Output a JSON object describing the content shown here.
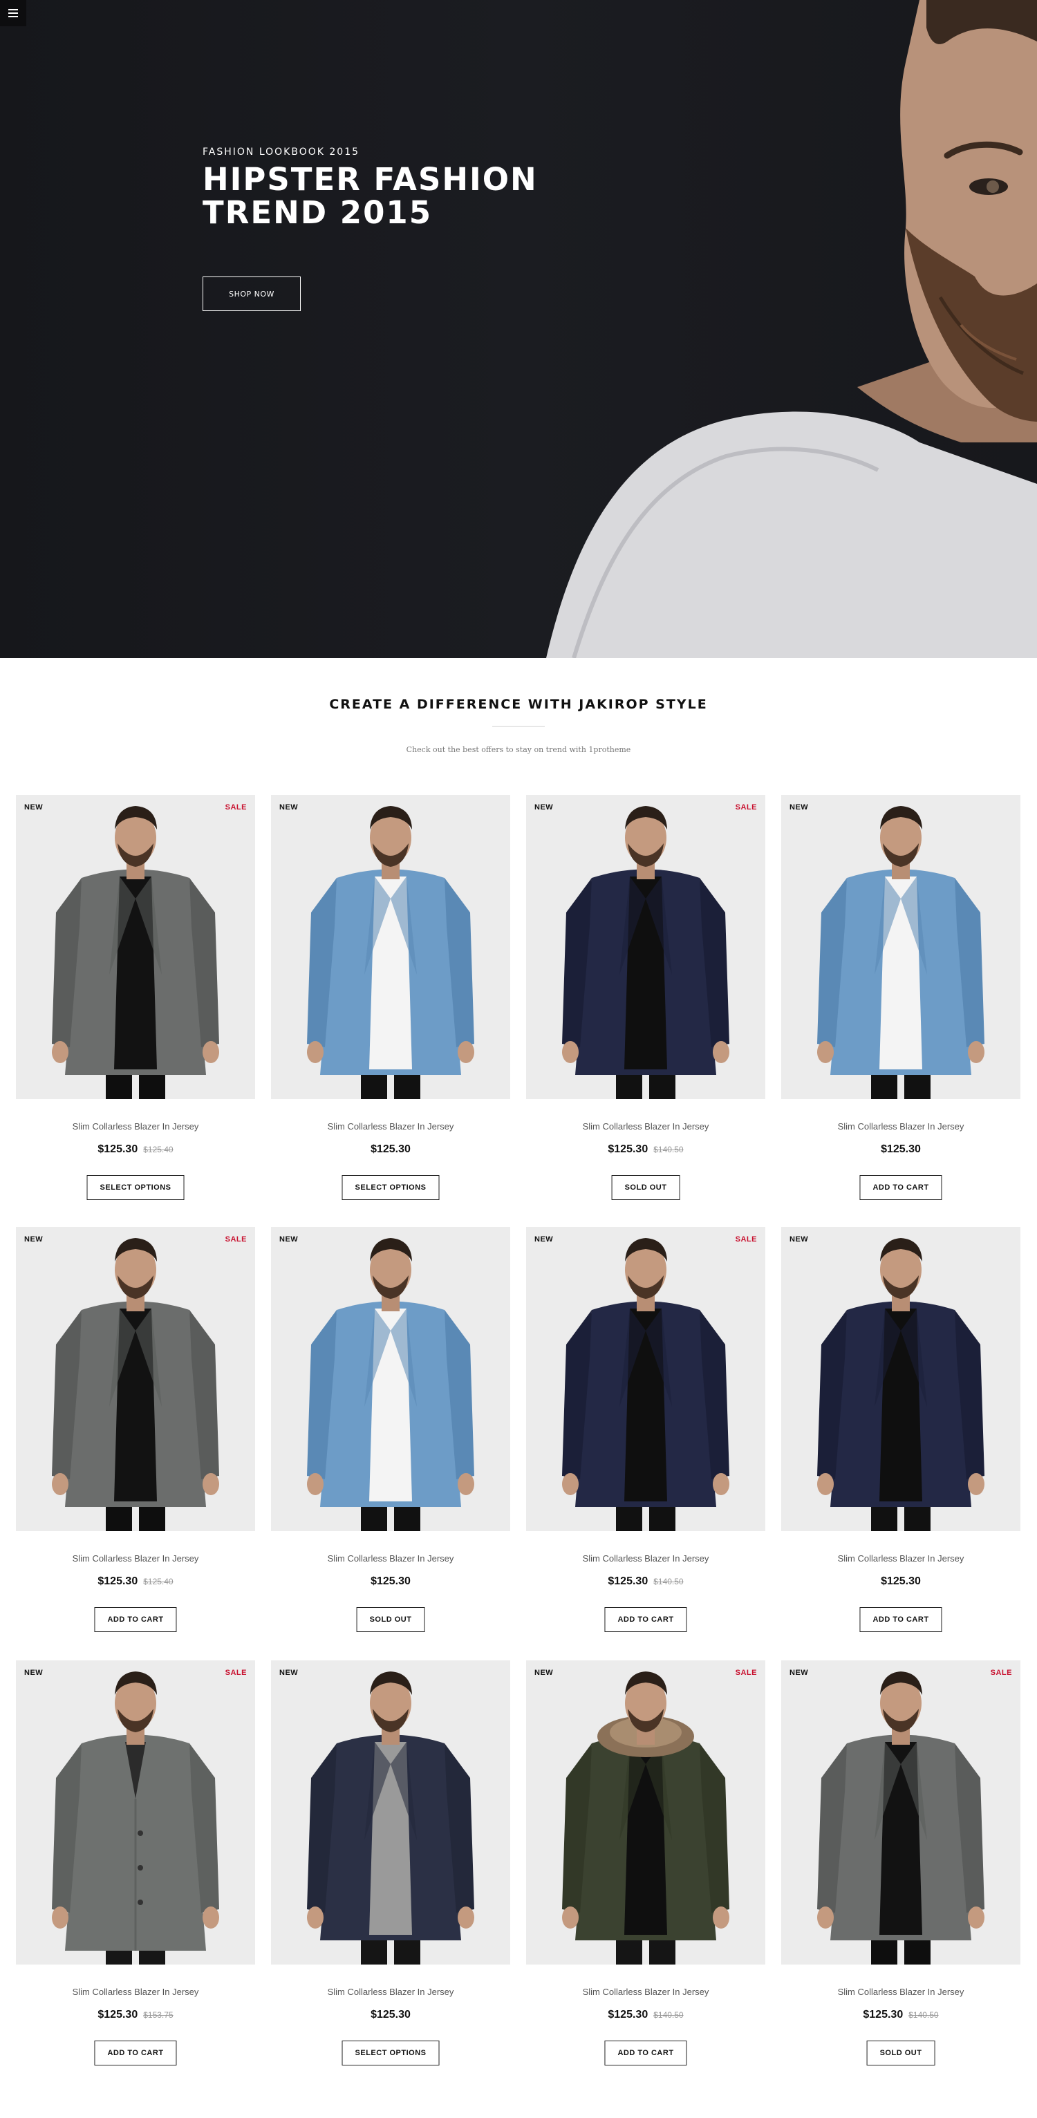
{
  "hero": {
    "kicker": "FASHION LOOKBOOK 2015",
    "title": "HIPSTER FASHION TREND 2015",
    "cta": "SHOP NOW"
  },
  "section": {
    "title": "CREATE A DIFFERENCE WITH JAKIROP STYLE",
    "subtitle": "Check out the best offers to stay on trend with 1protheme"
  },
  "colors": {
    "hero_bg": "#17181c",
    "sale_red": "#c8102e",
    "text_dark": "#111111",
    "text_muted": "#555555"
  },
  "products": [
    {
      "name": "Slim Collarless Blazer In Jersey",
      "price": "$125.30",
      "old_price": "$125.40",
      "new": "NEW",
      "sale": "SALE",
      "button": "SELECT OPTIONS",
      "garment": "grey-blazer"
    },
    {
      "name": "Slim Collarless Blazer In Jersey",
      "price": "$125.30",
      "old_price": "",
      "new": "NEW",
      "sale": "",
      "button": "SELECT OPTIONS",
      "garment": "denim-kimono"
    },
    {
      "name": "Slim Collarless Blazer In Jersey",
      "price": "$125.30",
      "old_price": "$140.50",
      "new": "NEW",
      "sale": "SALE",
      "button": "SOLD OUT",
      "garment": "navy-blazer"
    },
    {
      "name": "Slim Collarless Blazer In Jersey",
      "price": "$125.30",
      "old_price": "",
      "new": "NEW",
      "sale": "",
      "button": "ADD TO CART",
      "garment": "denim-kimono"
    },
    {
      "name": "Slim Collarless Blazer In Jersey",
      "price": "$125.30",
      "old_price": "$125.40",
      "new": "NEW",
      "sale": "SALE",
      "button": "ADD TO CART",
      "garment": "grey-blazer"
    },
    {
      "name": "Slim Collarless Blazer In Jersey",
      "price": "$125.30",
      "old_price": "",
      "new": "NEW",
      "sale": "",
      "button": "SOLD OUT",
      "garment": "denim-kimono"
    },
    {
      "name": "Slim Collarless Blazer In Jersey",
      "price": "$125.30",
      "old_price": "$140.50",
      "new": "NEW",
      "sale": "SALE",
      "button": "ADD TO CART",
      "garment": "navy-blazer"
    },
    {
      "name": "Slim Collarless Blazer In Jersey",
      "price": "$125.30",
      "old_price": "",
      "new": "NEW",
      "sale": "",
      "button": "ADD TO CART",
      "garment": "navy-blazer"
    },
    {
      "name": "Slim Collarless Blazer In Jersey",
      "price": "$125.30",
      "old_price": "$153.75",
      "new": "NEW",
      "sale": "SALE",
      "button": "ADD TO CART",
      "garment": "grey-overcoat"
    },
    {
      "name": "Slim Collarless Blazer In Jersey",
      "price": "$125.30",
      "old_price": "",
      "new": "NEW",
      "sale": "",
      "button": "SELECT OPTIONS",
      "garment": "navy-sweater-blazer"
    },
    {
      "name": "Slim Collarless Blazer In Jersey",
      "price": "$125.30",
      "old_price": "$140.50",
      "new": "NEW",
      "sale": "SALE",
      "button": "ADD TO CART",
      "garment": "green-parka"
    },
    {
      "name": "Slim Collarless Blazer In Jersey",
      "price": "$125.30",
      "old_price": "$140.50",
      "new": "NEW",
      "sale": "SALE",
      "button": "SOLD OUT",
      "garment": "grey-blazer"
    }
  ]
}
